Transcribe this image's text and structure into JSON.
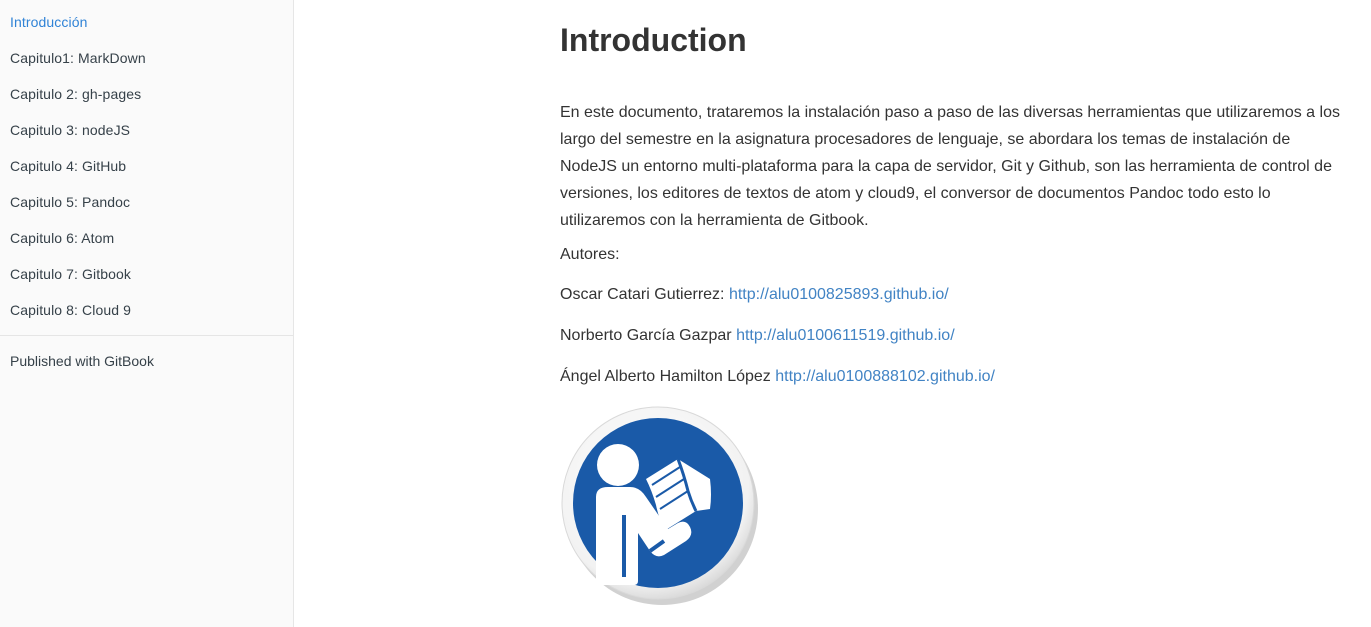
{
  "sidebar": {
    "items": [
      {
        "label": "Introducción",
        "active": true
      },
      {
        "label": "Capitulo1: MarkDown"
      },
      {
        "label": "Capitulo 2: gh-pages"
      },
      {
        "label": "Capitulo 3: nodeJS"
      },
      {
        "label": "Capitulo 4: GitHub"
      },
      {
        "label": "Capitulo 5: Pandoc"
      },
      {
        "label": "Capitulo 6: Atom"
      },
      {
        "label": "Capitulo 7: Gitbook"
      },
      {
        "label": "Capitulo 8: Cloud 9"
      }
    ],
    "published": "Published with GitBook"
  },
  "main": {
    "title": "Introduction",
    "intro": "En este documento, trataremos la instalación paso a paso de las diversas herramientas que utilizaremos a los largo del semestre en la asignatura procesadores de lenguaje, se abordara los temas de instalación de NodeJS un entorno multi-plataforma para la capa de servidor, Git y Github, son las herramienta de control de versiones, los editores de textos de atom y cloud9, el conversor de documentos Pandoc todo esto lo utilizaremos con la herramienta de Gitbook.",
    "authors_label": "Autores:",
    "authors": [
      {
        "name": "Oscar Catari Gutierrez:",
        "url": "http://alu0100825893.github.io/"
      },
      {
        "name": "Norberto García Gazpar",
        "url": "http://alu0100611519.github.io/"
      },
      {
        "name": "Ángel Alberto Hamilton López",
        "url": "http://alu0100888102.github.io/"
      }
    ],
    "image_icon": "reading-person-icon"
  },
  "colors": {
    "active_link": "#3083d6",
    "link": "#4183c4",
    "badge_blue": "#1a5aa8",
    "sidebar_bg": "#fafafa"
  }
}
